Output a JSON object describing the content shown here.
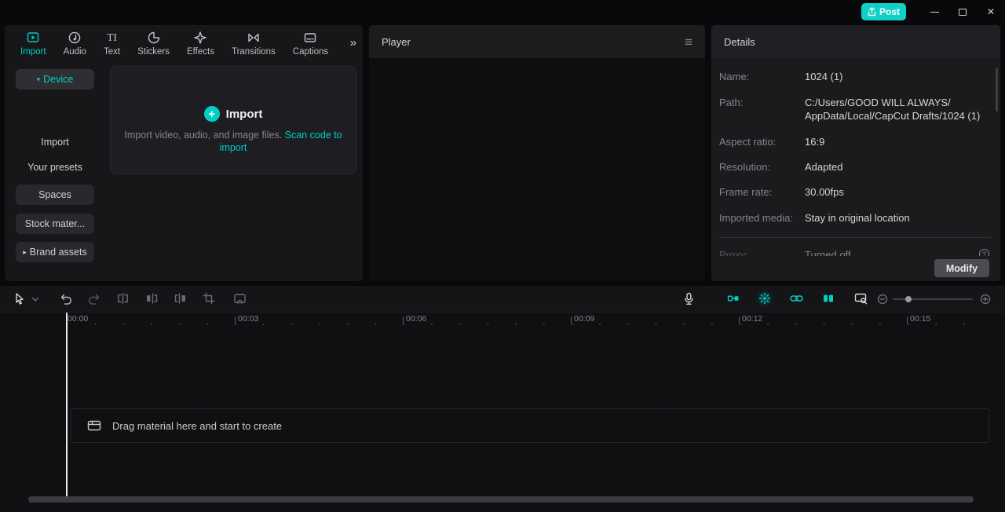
{
  "titlebar": {
    "post_label": "Post"
  },
  "icons": {
    "close": "✕",
    "chevrons_right": "»",
    "menu": "≡",
    "caret_down": "▾",
    "caret_right": "▸",
    "plus": "+",
    "text_icon": "TI",
    "info": "?"
  },
  "media_panel": {
    "tabs": [
      {
        "label": "Import"
      },
      {
        "label": "Audio"
      },
      {
        "label": "Text"
      },
      {
        "label": "Stickers"
      },
      {
        "label": "Effects"
      },
      {
        "label": "Transitions"
      },
      {
        "label": "Captions"
      }
    ],
    "sidebar": {
      "device_label": "Device",
      "items": [
        "Import",
        "Your presets",
        "Spaces",
        "Stock mater...",
        "Brand assets"
      ]
    },
    "import_box": {
      "title": "Import",
      "description": "Import video, audio, and image files. ",
      "link_label": "Scan code to import"
    }
  },
  "player": {
    "title": "Player"
  },
  "details": {
    "title": "Details",
    "fields": [
      {
        "label": "Name:",
        "value": "1024 (1)"
      },
      {
        "label": "Path:",
        "value_line1": "C:/Users/GOOD WILL ALWAYS/",
        "value_line2": "AppData/Local/CapCut Drafts/1024 (1)"
      },
      {
        "label": "Aspect ratio:",
        "value": "16:9"
      },
      {
        "label": "Resolution:",
        "value": "Adapted"
      },
      {
        "label": "Frame rate:",
        "value": "30.00fps"
      },
      {
        "label": "Imported media:",
        "value": "Stay in original location"
      },
      {
        "label": "Proxy:",
        "value": "Turned off"
      }
    ],
    "modify_label": "Modify"
  },
  "timeline": {
    "ruler": [
      "00:00",
      "00:03",
      "00:06",
      "00:09",
      "00:12",
      "00:15"
    ],
    "empty_hint": "Drag material here and start to create"
  },
  "colors": {
    "accent": "#00cfc4"
  }
}
